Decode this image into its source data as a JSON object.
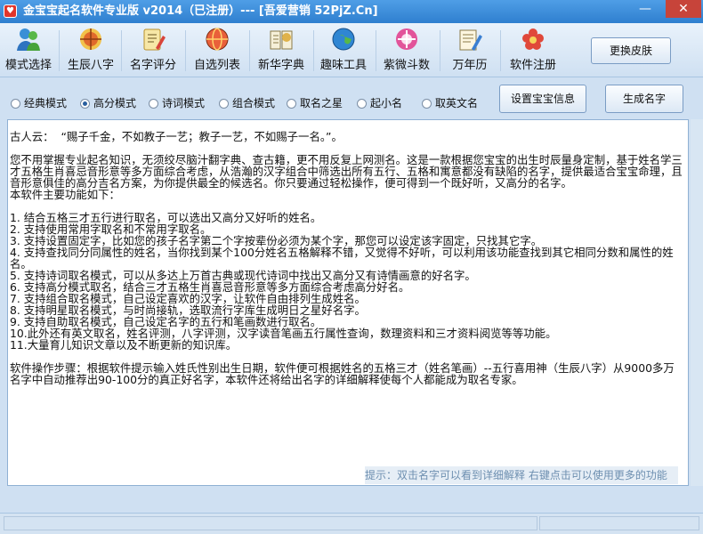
{
  "window": {
    "title": "金宝宝起名软件专业版 v2014（已注册）--- [吾爱营销 52PjZ.Cn]",
    "minimize_glyph": "—",
    "close_glyph": "✕"
  },
  "toolbar": {
    "items": [
      {
        "label": "模式选择",
        "icon": "users-icon"
      },
      {
        "label": "生辰八字",
        "icon": "astrology-icon"
      },
      {
        "label": "名字评分",
        "icon": "score-notepad-icon"
      },
      {
        "label": "自选列表",
        "icon": "list-globe-icon"
      },
      {
        "label": "新华字典",
        "icon": "dictionary-icon"
      },
      {
        "label": "趣味工具",
        "icon": "fun-tools-globe-icon"
      },
      {
        "label": "紫微斗数",
        "icon": "ziwei-icon"
      },
      {
        "label": "万年历",
        "icon": "calendar-pen-icon"
      },
      {
        "label": "软件注册",
        "icon": "register-flower-icon"
      }
    ],
    "skin_button": "更换皮肤"
  },
  "modes": {
    "options": [
      "经典模式",
      "高分模式",
      "诗词模式",
      "组合模式",
      "取名之星",
      "起小名",
      "取英文名"
    ],
    "selected": "高分模式"
  },
  "actions": {
    "settings_button": "设置宝宝信息",
    "generate_button": "生成名字"
  },
  "content": {
    "lines": [
      "古人云：  “赐子千金，不如教子一艺；教子一艺，不如赐子一名。”。",
      "",
      "您不用掌握专业起名知识，无须绞尽脑汁翻字典、查古籍，更不用反复上网测名。这是一款根据您宝宝的出生时辰量身定制，基于姓名学三才五格生肖喜忌音形意等多方面综合考虑，从浩瀚的汉字组合中筛选出所有五行、五格和寓意都没有缺陷的名字，提供最适合宝宝命理，且音形意俱佳的高分吉名方案，为你提供最全的候选名。你只要通过轻松操作，便可得到一个既好听，又高分的名字。",
      "本软件主要功能如下：",
      "",
      "1. 结合五格三才五行进行取名，可以选出又高分又好听的姓名。",
      "2. 支持使用常用字取名和不常用字取名。",
      "3. 支持设置固定字，比如您的孩子名字第二个字按辈份必须为某个字，那您可以设定该字固定，只找其它字。",
      "4. 支持查找同分同属性的姓名，当你找到某个100分姓名五格解释不错，又觉得不好听，可以利用该功能查找到其它相同分数和属性的姓名。",
      "5. 支持诗词取名模式，可以从多达上万首古典或现代诗词中找出又高分又有诗情画意的好名字。",
      "6. 支持高分模式取名，结合三才五格生肖喜忌音形意等多方面综合考虑高分好名。",
      "7. 支持组合取名模式，自己设定喜欢的汉字，让软件自由排列生成姓名。",
      "8. 支持明星取名模式，与时尚接轨，选取流行字库生成明日之星好名字。",
      "9. 支持自助取名模式，自己设定名字的五行和笔画数进行取名。",
      "10.此外还有英文取名，姓名评测，八字评测，汉字读音笔画五行属性查询，数理资料和三才资料阅览等等功能。",
      "11.大量育儿知识文章以及不断更新的知识库。",
      "",
      "软件操作步骤：根据软件提示输入姓氏性别出生日期，软件便可根据姓名的五格三才（姓名笔画）--五行喜用神（生辰八字）从9000多万名字中自动推荐出90-100分的真正好名字，本软件还将给出名字的详细解释使每个人都能成为取名专家。"
    ],
    "hint": "提示：双击名字可以看到详细解释   右键点击可以使用更多的功能"
  },
  "colors": {
    "titlebar": "#2f7fcf",
    "panel_bg": "#cfe0f2",
    "hint_text": "#6d8fb0",
    "close_red": "#c7443a"
  }
}
